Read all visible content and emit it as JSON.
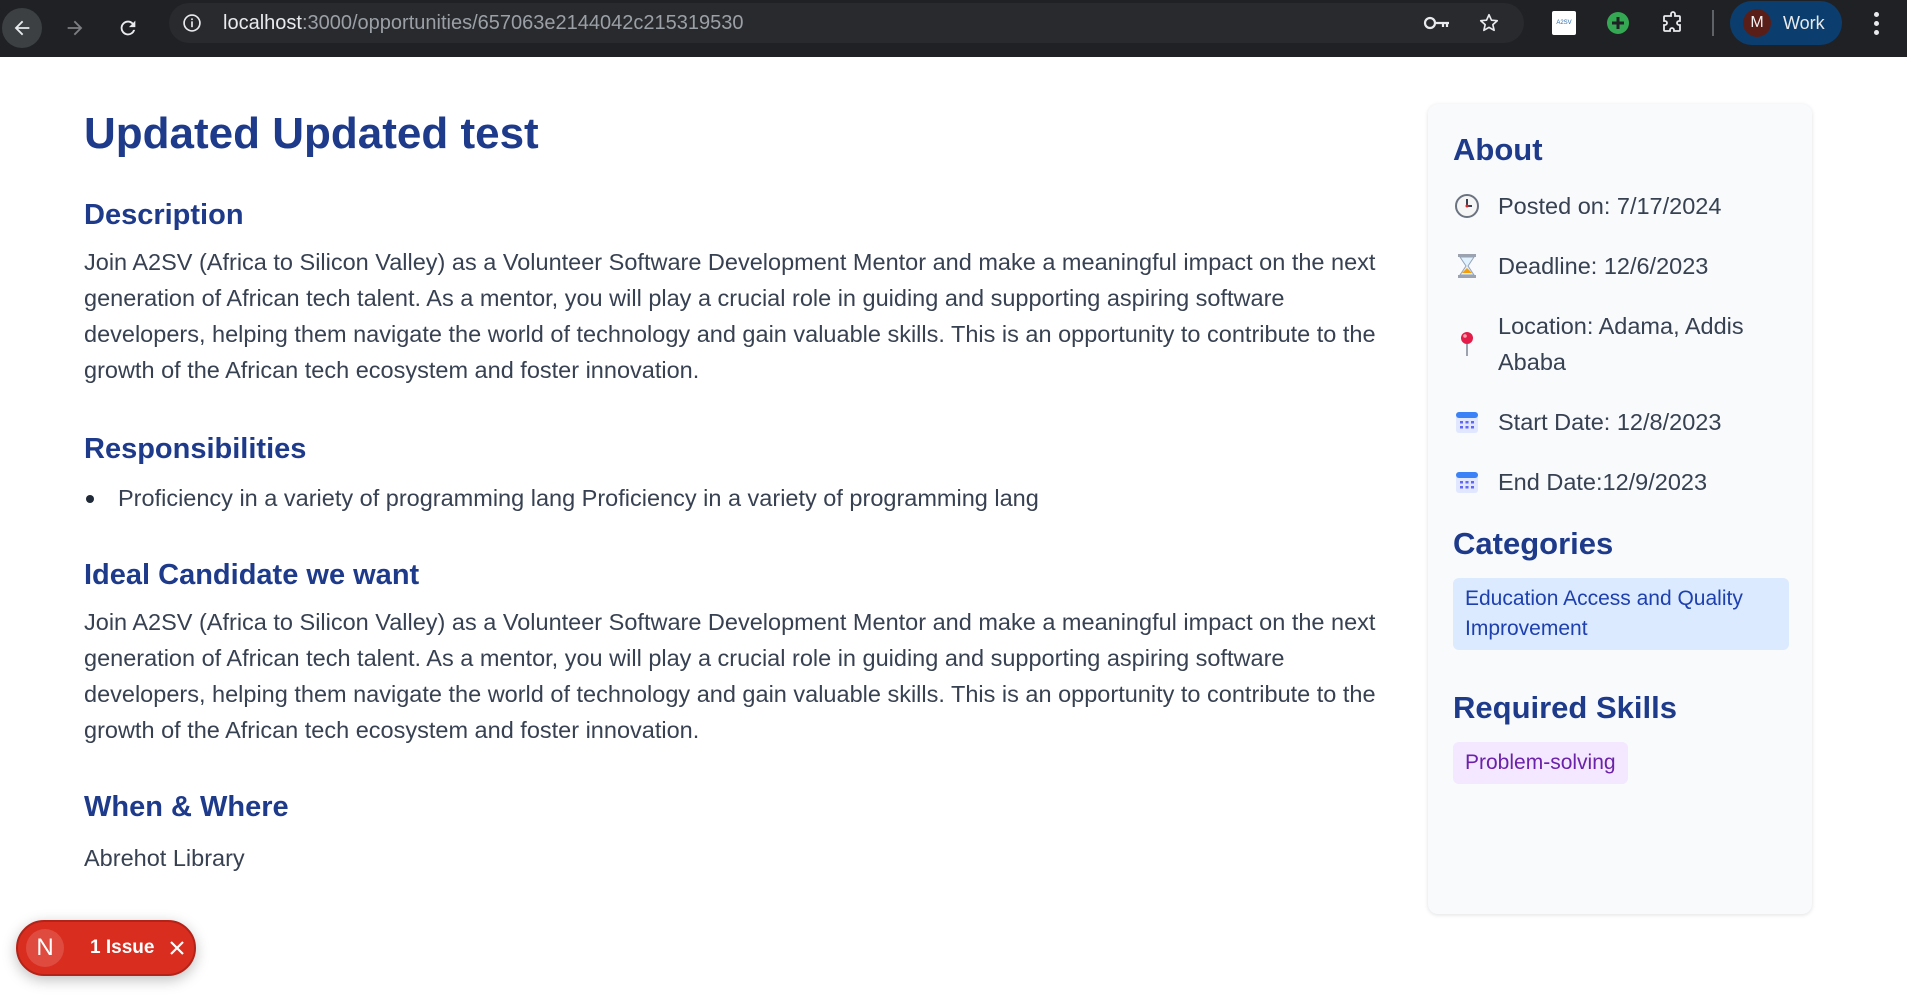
{
  "browser": {
    "url_host": "localhost",
    "url_path": ":3000/opportunities/657063e2144042c215319530",
    "profile_initial": "M",
    "profile_name": "Work",
    "extension_label": "A2SV"
  },
  "opportunity": {
    "title": "Updated Updated test",
    "description_heading": "Description",
    "description": "Join A2SV (Africa to Silicon Valley) as a Volunteer Software Development Mentor and make a meaningful impact on the next generation of African tech talent. As a mentor, you will play a crucial role in guiding and supporting aspiring software developers, helping them navigate the world of technology and gain valuable skills. This is an opportunity to contribute to the growth of the African tech ecosystem and foster innovation.",
    "responsibilities_heading": "Responsibilities",
    "responsibilities": [
      "Proficiency in a variety of programming lang Proficiency in a variety of programming lang"
    ],
    "ideal_heading": "Ideal Candidate we want",
    "ideal_text": "Join A2SV (Africa to Silicon Valley) as a Volunteer Software Development Mentor and make a meaningful impact on the next generation of African tech talent. As a mentor, you will play a crucial role in guiding and supporting aspiring software developers, helping them navigate the world of technology and gain valuable skills. This is an opportunity to contribute to the growth of the African tech ecosystem and foster innovation.",
    "when_heading": "When & Where",
    "when_text": "Abrehot Library"
  },
  "about": {
    "heading": "About",
    "posted": "Posted on: 7/17/2024",
    "deadline": "Deadline: 12/6/2023",
    "location": "Location: Adama, Addis Ababa",
    "start": "Start Date: 12/8/2023",
    "end": "End Date:12/9/2023",
    "icons": [
      "clock-icon",
      "hourglass-icon",
      "pin-icon",
      "calendar-icon",
      "calendar-icon"
    ]
  },
  "categories": {
    "heading": "Categories",
    "items": [
      "Education Access and Quality Improvement"
    ]
  },
  "skills": {
    "heading": "Required Skills",
    "items": [
      "Problem-solving"
    ]
  },
  "dev_overlay": {
    "initial": "N",
    "label": "1 Issue"
  },
  "colors": {
    "heading": "#1e3a8a",
    "category_bg": "#dbeafe",
    "skill_bg": "#f3e8ff",
    "issue_badge": "#d92d20"
  }
}
